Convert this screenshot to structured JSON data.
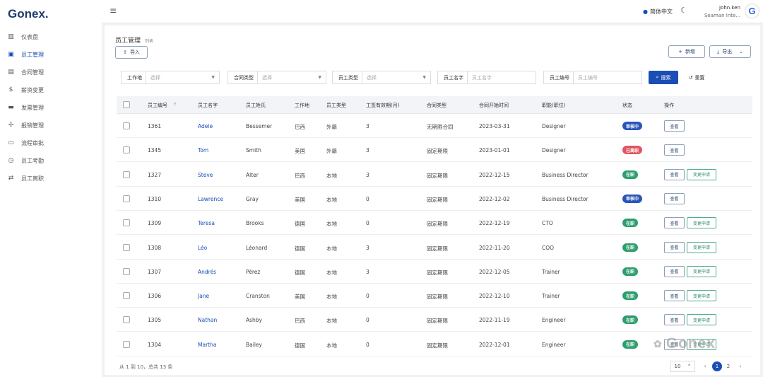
{
  "app": {
    "logo": "Gonex."
  },
  "sidebar": {
    "items": [
      {
        "label": "仪表盘",
        "icon": "chart-bars-icon",
        "glyph": "▥",
        "active": false
      },
      {
        "label": "员工管理",
        "icon": "person-card-icon",
        "glyph": "▣",
        "active": true
      },
      {
        "label": "合同管理",
        "icon": "document-icon",
        "glyph": "▤",
        "active": false
      },
      {
        "label": "薪资变更",
        "icon": "dollar-icon",
        "glyph": "$",
        "active": false
      },
      {
        "label": "发票管理",
        "icon": "briefcase-icon",
        "glyph": "▬",
        "active": false
      },
      {
        "label": "报销管理",
        "icon": "pin-icon",
        "glyph": "✢",
        "active": false
      },
      {
        "label": "流程审批",
        "icon": "id-card-icon",
        "glyph": "▭",
        "active": false
      },
      {
        "label": "员工考勤",
        "icon": "clock-icon",
        "glyph": "◷",
        "active": false
      },
      {
        "label": "员工离职",
        "icon": "swap-arrows-icon",
        "glyph": "⇄",
        "active": false
      }
    ]
  },
  "topbar": {
    "language": "简体中文",
    "user_name": "John.ken",
    "user_company": "Seaman Inte...",
    "avatar_letter": "G"
  },
  "page": {
    "title": "员工管理",
    "subtitle": "列表",
    "import_label": "导入",
    "add_label": "新增",
    "export_label": "导出"
  },
  "filters": {
    "workplace_label": "工作地",
    "workplace_placeholder": "选择",
    "contract_type_label": "合同类型",
    "contract_type_placeholder": "选择",
    "employee_type_label": "员工类型",
    "employee_type_placeholder": "选择",
    "employee_name_label": "员工名字",
    "employee_name_placeholder": "员工名字",
    "employee_id_label": "员工编号",
    "employee_id_placeholder": "员工编号",
    "search_label": "搜索",
    "reset_label": "重置"
  },
  "table": {
    "headers": [
      "员工编号",
      "员工名字",
      "员工姓氏",
      "工作地",
      "员工类型",
      "工签有效期(月)",
      "合同类型",
      "合同开始时间",
      "职能(职位)",
      "状态",
      "操作"
    ],
    "view_label": "查看",
    "change_label": "变更申请",
    "rows": [
      {
        "id": "1361",
        "first": "Adele",
        "last": "Bessemer",
        "place": "巴西",
        "type": "外籍",
        "visa": "3",
        "contract": "无期限合同",
        "start": "2023-03-31",
        "role": "Designer",
        "status": "审核中",
        "status_color": "#2a55b8",
        "change": false
      },
      {
        "id": "1345",
        "first": "Tom",
        "last": "Smith",
        "place": "美国",
        "type": "外籍",
        "visa": "3",
        "contract": "固定期限",
        "start": "2023-01-01",
        "role": "Designer",
        "status": "已离职",
        "status_color": "#e05561",
        "change": false
      },
      {
        "id": "1327",
        "first": "Steve",
        "last": "Alter",
        "place": "巴西",
        "type": "本地",
        "visa": "3",
        "contract": "固定期限",
        "start": "2022-12-15",
        "role": "Business Director",
        "status": "在职",
        "status_color": "#2e9e6e",
        "change": true
      },
      {
        "id": "1310",
        "first": "Lawrence",
        "last": "Gray",
        "place": "美国",
        "type": "本地",
        "visa": "0",
        "contract": "固定期限",
        "start": "2022-12-02",
        "role": "Business Director",
        "status": "审核中",
        "status_color": "#2a55b8",
        "change": false
      },
      {
        "id": "1309",
        "first": "Teresa",
        "last": "Brooks",
        "place": "德国",
        "type": "本地",
        "visa": "0",
        "contract": "固定期限",
        "start": "2022-12-19",
        "role": "CTO",
        "status": "在职",
        "status_color": "#2e9e6e",
        "change": true
      },
      {
        "id": "1308",
        "first": "Léo",
        "last": "Léonard",
        "place": "德国",
        "type": "本地",
        "visa": "3",
        "contract": "固定期限",
        "start": "2022-11-20",
        "role": "COO",
        "status": "在职",
        "status_color": "#2e9e6e",
        "change": true
      },
      {
        "id": "1307",
        "first": "Andrés",
        "last": "Pérez",
        "place": "德国",
        "type": "本地",
        "visa": "3",
        "contract": "固定期限",
        "start": "2022-12-05",
        "role": "Trainer",
        "status": "在职",
        "status_color": "#2e9e6e",
        "change": true
      },
      {
        "id": "1306",
        "first": "Jane",
        "last": "Cranston",
        "place": "美国",
        "type": "本地",
        "visa": "0",
        "contract": "固定期限",
        "start": "2022-12-10",
        "role": "Trainer",
        "status": "在职",
        "status_color": "#2e9e6e",
        "change": true
      },
      {
        "id": "1305",
        "first": "Nathan",
        "last": "Ashby",
        "place": "巴西",
        "type": "本地",
        "visa": "0",
        "contract": "固定期限",
        "start": "2022-11-19",
        "role": "Engineer",
        "status": "在职",
        "status_color": "#2e9e6e",
        "change": true
      },
      {
        "id": "1304",
        "first": "Martha",
        "last": "Bailey",
        "place": "德国",
        "type": "本地",
        "visa": "0",
        "contract": "固定期限",
        "start": "2022-12-01",
        "role": "Engineer",
        "status": "在职",
        "status_color": "#2e9e6e",
        "change": true
      }
    ]
  },
  "footer": {
    "summary": "从 1 到 10，总共 13 条",
    "page_size": "10",
    "pages": [
      "1",
      "2"
    ],
    "current_page": "1"
  },
  "watermark": "Gonex"
}
